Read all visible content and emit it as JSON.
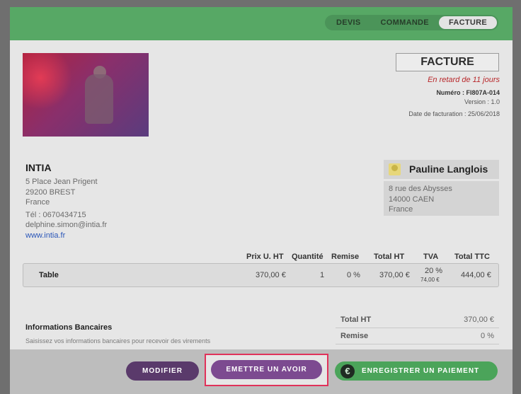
{
  "tabs": [
    {
      "label": "DEVIS",
      "active": false
    },
    {
      "label": "COMMANDE",
      "active": false
    },
    {
      "label": "FACTURE",
      "active": true
    }
  ],
  "document": {
    "title": "FACTURE",
    "late_status": "En retard de 11 jours",
    "number_label": "Numéro :",
    "number": "FI807A-014",
    "version": "Version : 1.0",
    "date": "Date de facturation : 25/06/2018"
  },
  "company": {
    "name": "INTIA",
    "lines": [
      "5 Place Jean Prigent",
      "29200 BREST",
      "France"
    ],
    "phone": "Tél : 0670434715",
    "email": "delphine.simon@intia.fr",
    "website": "www.intia.fr"
  },
  "client": {
    "name": "Pauline Langlois",
    "lines": [
      "8 rue des Abysses",
      "14000 CAEN",
      "France"
    ],
    "avatar_icon": "user-icon"
  },
  "table": {
    "headers": {
      "prix": "Prix U. HT",
      "quantite": "Quantité",
      "remise": "Remise",
      "total_ht": "Total HT",
      "tva": "TVA",
      "total_ttc": "Total TTC"
    },
    "rows": [
      {
        "designation": "Table",
        "prix": "370,00 €",
        "quantite": "1",
        "remise": "0 %",
        "total_ht": "370,00 €",
        "tva_rate": "20 %",
        "tva_amount": "74,00 €",
        "total_ttc": "444,00 €"
      }
    ]
  },
  "bank": {
    "title": "Informations Bancaires",
    "subtitle": "Saisissez vos informations bancaires pour recevoir des virements"
  },
  "totals": [
    {
      "label": "Total HT",
      "value": "370,00 €"
    },
    {
      "label": "Remise",
      "value": "0 %"
    }
  ],
  "actions": {
    "modifier": "MODIFIER",
    "avoir": "EMETTRE UN AVOIR",
    "paiement": "ENREGISTRER UN PAIEMENT",
    "paiement_icon": "euro-icon"
  },
  "colors": {
    "topbar": "#57a865",
    "late": "#b8282b",
    "link": "#2a56b8",
    "avoir_button": "#7c4a90",
    "highlight_border": "#e0325a"
  }
}
